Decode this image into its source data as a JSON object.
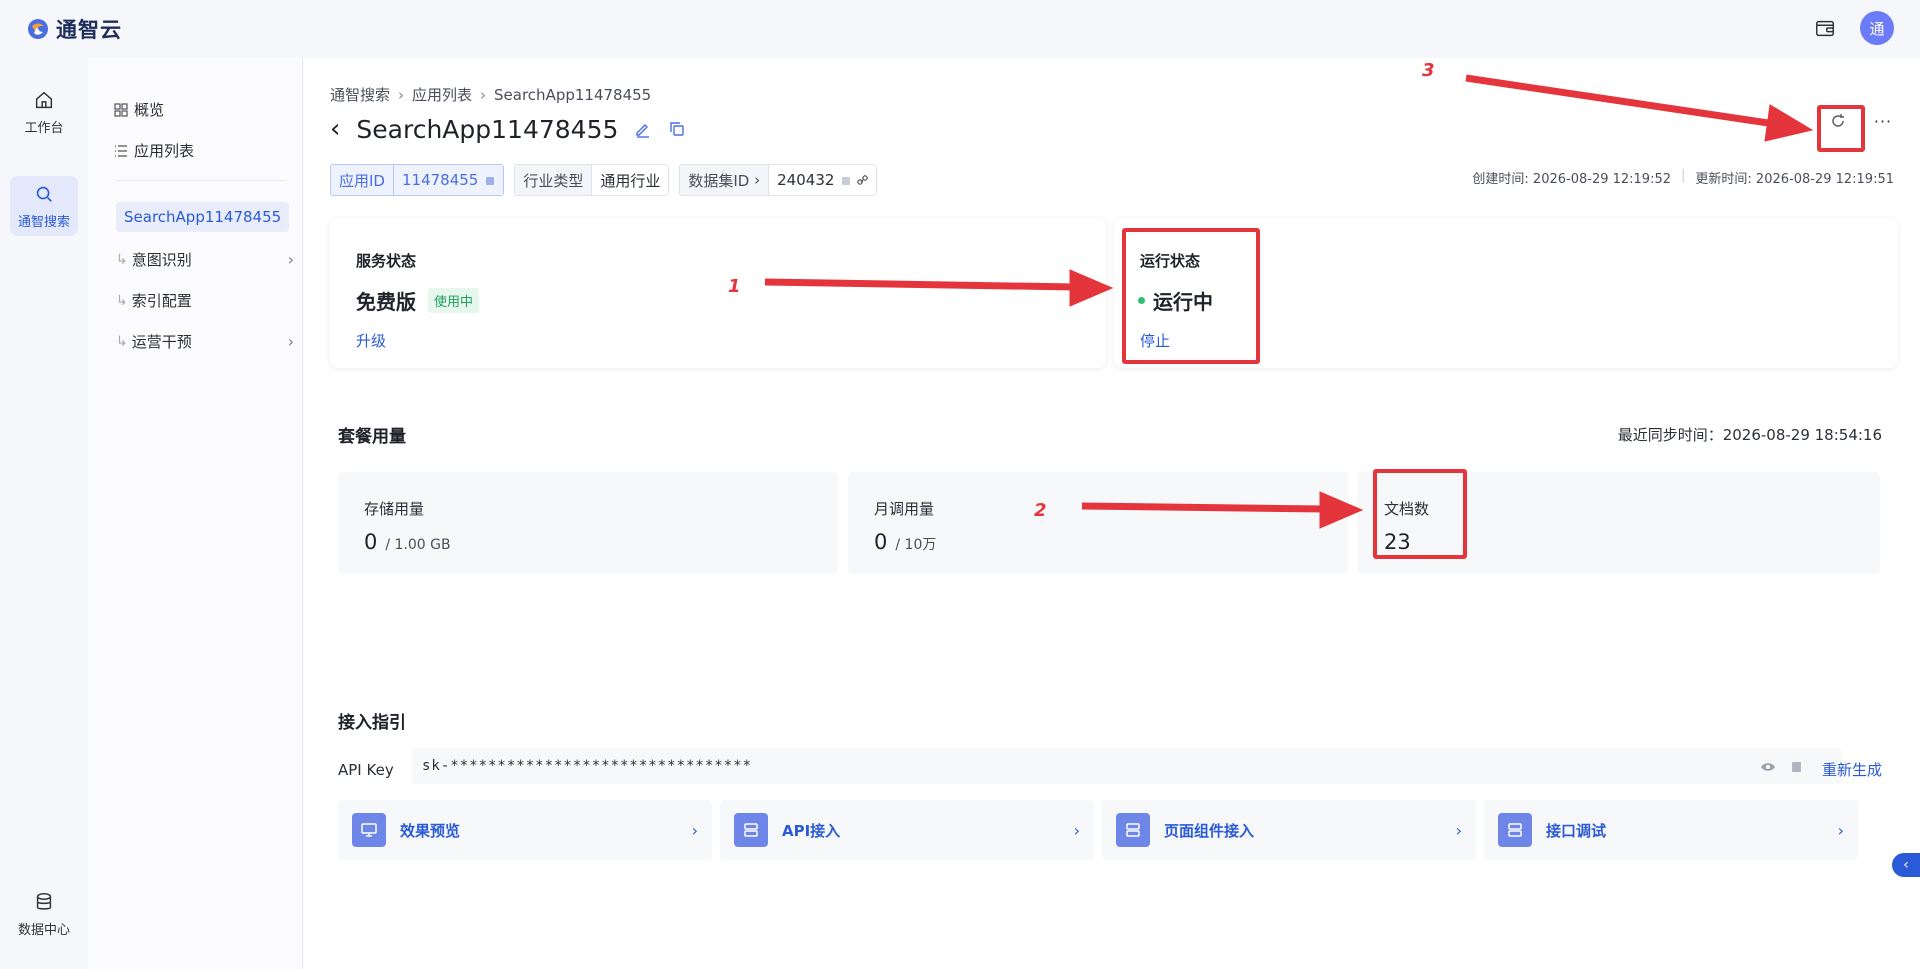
{
  "brand": {
    "name": "通智云"
  },
  "user": {
    "avatar_initial": "通"
  },
  "rail": {
    "workbench": "工作台",
    "search": "通智搜索",
    "data_center": "数据中心"
  },
  "sidebar": {
    "overview": "概览",
    "app_list": "应用列表",
    "current_app": "SearchApp11478455",
    "intent": "意图识别",
    "index": "索引配置",
    "ops": "运营干预"
  },
  "breadcrumb": {
    "root": "通智搜索",
    "list": "应用列表",
    "current": "SearchApp11478455"
  },
  "header": {
    "title": "SearchApp11478455"
  },
  "chips": {
    "app_id_key": "应用ID",
    "app_id_value": "11478455",
    "industry_key": "行业类型",
    "industry_value": "通用行业",
    "dataset_key": "数据集ID",
    "dataset_value": "240432"
  },
  "timestamps": {
    "created": "创建时间: 2026-08-29 12:19:52",
    "updated": "更新时间: 2026-08-29 12:19:51"
  },
  "service": {
    "label": "服务状态",
    "plan": "免费版",
    "badge": "使用中",
    "upgrade": "升级"
  },
  "running": {
    "label": "运行状态",
    "state": "运行中",
    "stop": "停止"
  },
  "usage": {
    "title": "套餐用量",
    "sync_time": "最近同步时间：2026-08-29 18:54:16",
    "storage_label": "存储用量",
    "storage_value": "0",
    "storage_unit": "/ 1.00 GB",
    "calls_label": "月调用量",
    "calls_value": "0",
    "calls_unit": "/ 10万",
    "docs_label": "文档数",
    "docs_value": "23"
  },
  "guide": {
    "title": "接入指引",
    "apikey_label": "API Key",
    "apikey_value": "sk-********************************",
    "regenerate": "重新生成",
    "entries": [
      "效果预览",
      "API接入",
      "页面组件接入",
      "接口调试"
    ]
  },
  "annotations": {
    "one": "1",
    "two": "2",
    "three": "3"
  },
  "colors": {
    "accent": "#2a5ad7",
    "annotation": "#e5353c",
    "success": "#2fbf71"
  }
}
